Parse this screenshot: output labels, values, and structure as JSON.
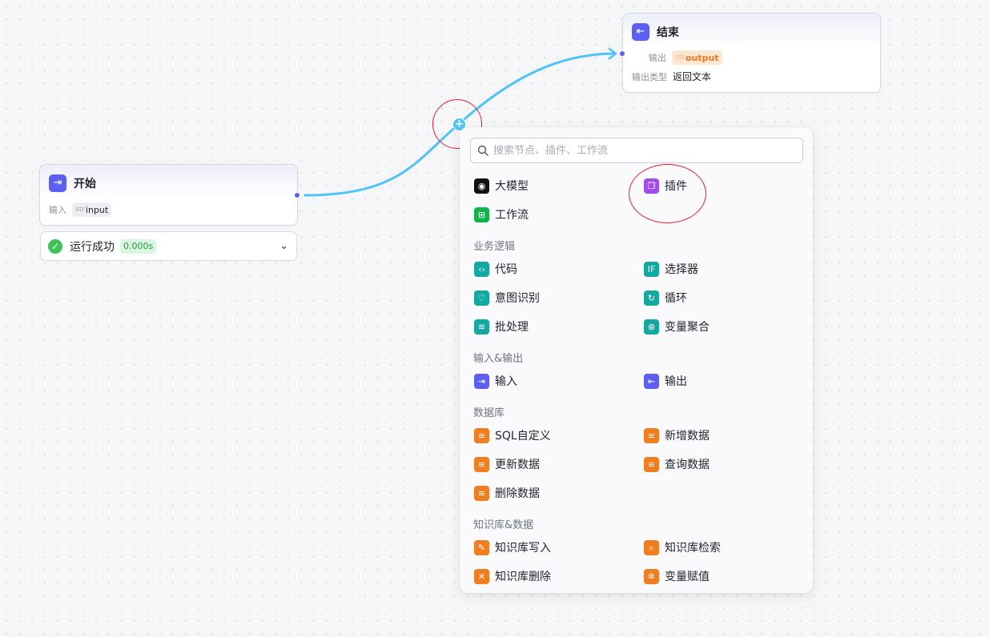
{
  "start_node": {
    "title": "开始",
    "input_label": "输入",
    "input_type": "str",
    "input_name": "input",
    "icon": "login-icon"
  },
  "run_status": {
    "label": "运行成功",
    "time": "0.000s"
  },
  "end_node": {
    "title": "结束",
    "output_label": "输出",
    "output_type": "str",
    "output_name": "output",
    "output_type_label": "输出类型",
    "output_type_value": "返回文本",
    "icon": "logout-icon"
  },
  "colors": {
    "node_accent": "#5d5ff2",
    "edge": "#4fc3f7",
    "success": "#3ec25b",
    "annotation": "#e4212b"
  },
  "panel": {
    "search_placeholder": "搜索节点、插件、工作流",
    "top_items": [
      {
        "label": "大模型",
        "icon": "llm-icon"
      },
      {
        "label": "插件",
        "icon": "plugin-cube-icon"
      },
      {
        "label": "工作流",
        "icon": "workflow-icon"
      }
    ],
    "sections": [
      {
        "title": "业务逻辑",
        "items": [
          {
            "label": "代码",
            "icon": "code-icon"
          },
          {
            "label": "选择器",
            "icon": "if-icon"
          },
          {
            "label": "意图识别",
            "icon": "intent-icon"
          },
          {
            "label": "循环",
            "icon": "loop-icon"
          },
          {
            "label": "批处理",
            "icon": "batch-icon"
          },
          {
            "label": "变量聚合",
            "icon": "aggregate-icon"
          }
        ]
      },
      {
        "title": "输入&输出",
        "items": [
          {
            "label": "输入",
            "icon": "input-icon"
          },
          {
            "label": "输出",
            "icon": "output-icon"
          }
        ]
      },
      {
        "title": "数据库",
        "items": [
          {
            "label": "SQL自定义",
            "icon": "database-icon"
          },
          {
            "label": "新增数据",
            "icon": "database-add-icon"
          },
          {
            "label": "更新数据",
            "icon": "database-update-icon"
          },
          {
            "label": "查询数据",
            "icon": "database-query-icon"
          },
          {
            "label": "删除数据",
            "icon": "database-delete-icon"
          }
        ]
      },
      {
        "title": "知识库&数据",
        "items": [
          {
            "label": "知识库写入",
            "icon": "kb-write-icon"
          },
          {
            "label": "知识库检索",
            "icon": "kb-search-icon"
          },
          {
            "label": "知识库删除",
            "icon": "kb-delete-icon"
          },
          {
            "label": "变量赋值",
            "icon": "variable-assign-icon"
          }
        ]
      }
    ]
  }
}
